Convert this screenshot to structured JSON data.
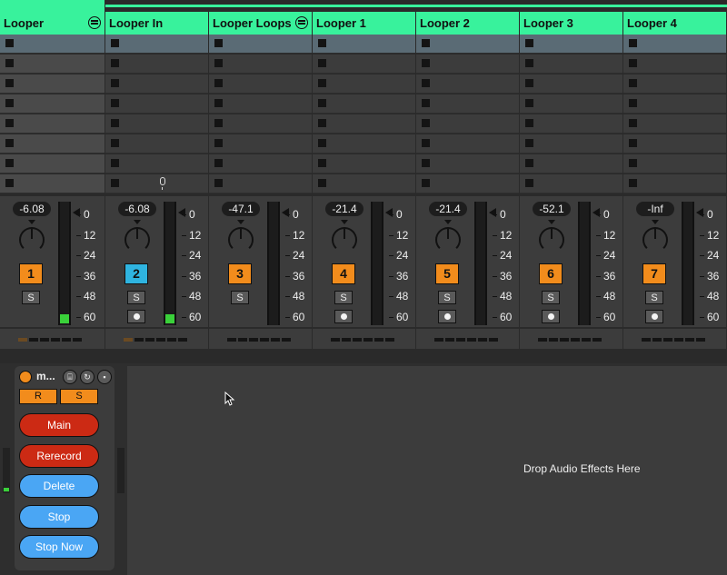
{
  "tracks": [
    {
      "name": "Looper",
      "number": "1",
      "volume": "-6.08",
      "color": "orange",
      "has_meter_signal": true,
      "has_arm": false
    },
    {
      "name": "Looper In",
      "number": "2",
      "volume": "-6.08",
      "color": "blue",
      "has_meter_signal": true,
      "has_arm": true
    },
    {
      "name": "Looper Loops",
      "number": "3",
      "volume": "-47.1",
      "color": "orange",
      "has_meter_signal": false,
      "has_arm": false
    },
    {
      "name": "Looper 1",
      "number": "4",
      "volume": "-21.4",
      "color": "orange",
      "has_meter_signal": false,
      "has_arm": true
    },
    {
      "name": "Looper 2",
      "number": "5",
      "volume": "-21.4",
      "color": "orange",
      "has_meter_signal": false,
      "has_arm": true
    },
    {
      "name": "Looper 3",
      "number": "6",
      "volume": "-52.1",
      "color": "orange",
      "has_meter_signal": false,
      "has_arm": true
    },
    {
      "name": "Looper 4",
      "number": "7",
      "volume": "-Inf",
      "color": "orange",
      "has_meter_signal": false,
      "has_arm": true
    }
  ],
  "solo_label": "S",
  "meter_scale": [
    "0",
    "12",
    "24",
    "36",
    "48",
    "60"
  ],
  "device": {
    "title": "m...",
    "r_label": "R",
    "s_label": "S",
    "buttons": [
      {
        "label": "Main",
        "color": "red"
      },
      {
        "label": "Rerecord",
        "color": "red"
      },
      {
        "label": "Delete",
        "color": "blue"
      },
      {
        "label": "Stop",
        "color": "blue"
      },
      {
        "label": "Stop Now",
        "color": "blue"
      }
    ]
  },
  "drop_hint": "Drop Audio Effects Here",
  "colors": {
    "header": "#38f29c",
    "orange": "#f28c1c",
    "blue": "#2fb4e0",
    "red": "#cc2a14",
    "pill_blue": "#4aa6f4"
  }
}
